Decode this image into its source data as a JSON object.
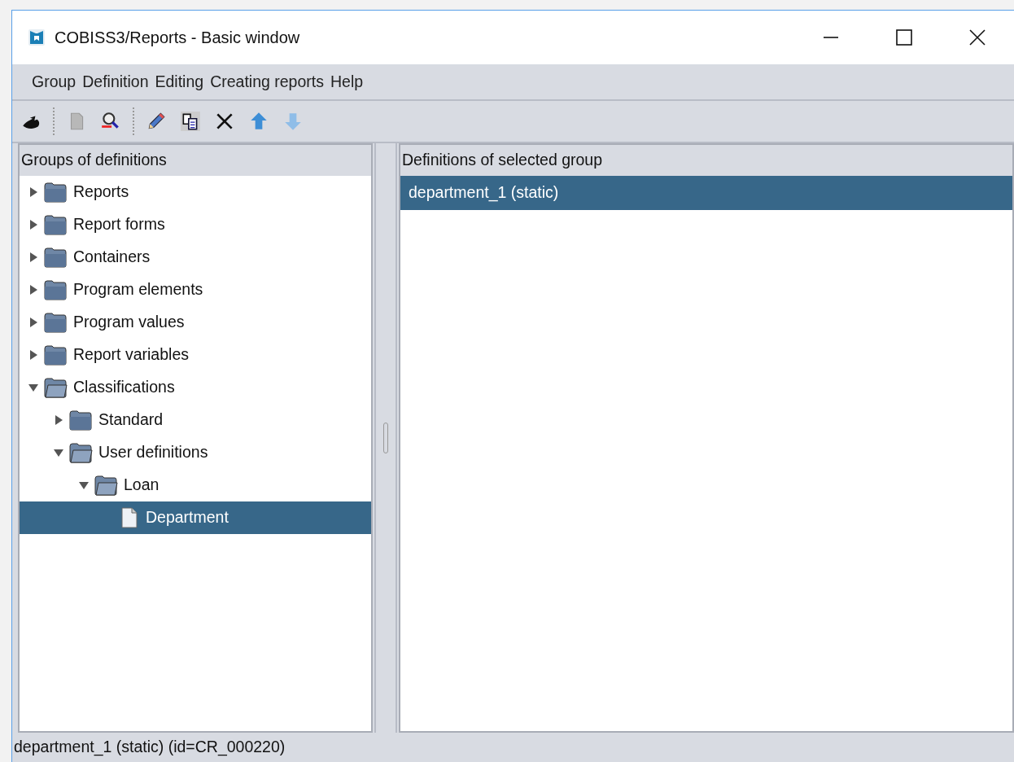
{
  "window": {
    "title": "COBISS3/Reports - Basic window"
  },
  "menu": [
    "Group",
    "Definition",
    "Editing",
    "Creating reports",
    "Help"
  ],
  "toolbar": [
    {
      "kind": "exit",
      "disabled": false
    },
    {
      "kind": "separator"
    },
    {
      "kind": "new",
      "disabled": true
    },
    {
      "kind": "find",
      "disabled": false
    },
    {
      "kind": "separator"
    },
    {
      "kind": "edit",
      "disabled": false
    },
    {
      "kind": "copy",
      "disabled": false
    },
    {
      "kind": "delete",
      "disabled": false
    },
    {
      "kind": "up",
      "disabled": false
    },
    {
      "kind": "down",
      "disabled": true
    }
  ],
  "tree": {
    "header": "Groups of definitions",
    "items": [
      {
        "label": "Reports",
        "kind": "folder",
        "expanded": false,
        "selected": false
      },
      {
        "label": "Report forms",
        "kind": "folder",
        "expanded": false,
        "selected": false
      },
      {
        "label": "Containers",
        "kind": "folder",
        "expanded": false,
        "selected": false
      },
      {
        "label": "Program elements",
        "kind": "folder",
        "expanded": false,
        "selected": false
      },
      {
        "label": "Program values",
        "kind": "folder",
        "expanded": false,
        "selected": false
      },
      {
        "label": "Report variables",
        "kind": "folder",
        "expanded": false,
        "selected": false
      },
      {
        "label": "Classifications",
        "kind": "folder",
        "expanded": true,
        "selected": false,
        "children": [
          {
            "label": "Standard",
            "kind": "folder",
            "expanded": false,
            "selected": false
          },
          {
            "label": "User definitions",
            "kind": "folder",
            "expanded": true,
            "selected": false,
            "children": [
              {
                "label": "Loan",
                "kind": "folder",
                "expanded": true,
                "selected": false,
                "children": [
                  {
                    "label": "Department",
                    "kind": "document",
                    "selected": true
                  }
                ]
              }
            ]
          }
        ]
      }
    ]
  },
  "definitions": {
    "header": "Definitions of selected group",
    "items": [
      {
        "label": "department_1 (static)",
        "selected": true
      }
    ]
  },
  "status_bar": "department_1 (static) (id=CR_000220)"
}
